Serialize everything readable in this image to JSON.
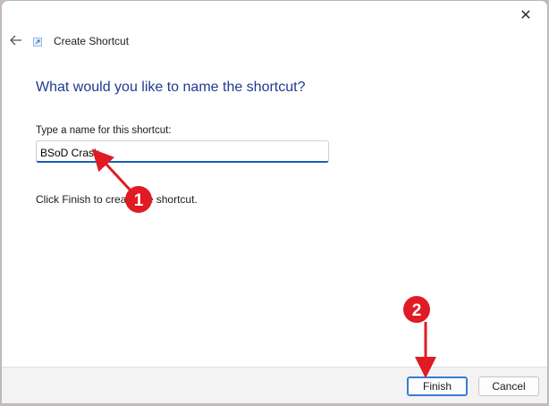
{
  "window": {
    "title": "Create Shortcut",
    "close_glyph": "✕",
    "back_icon": "back-arrow-icon"
  },
  "main": {
    "heading": "What would you like to name the shortcut?",
    "field_label": "Type a name for this shortcut:",
    "name_value": "BSoD Crash",
    "hint": "Click Finish to create the shortcut."
  },
  "footer": {
    "finish_label": "Finish",
    "cancel_label": "Cancel"
  },
  "annotations": {
    "marker_1": "1",
    "marker_2": "2",
    "color": "#e01b24"
  },
  "colors": {
    "heading": "#1f3a93",
    "input_underline": "#1a5fb4",
    "primary_border": "#3a7bd5"
  }
}
